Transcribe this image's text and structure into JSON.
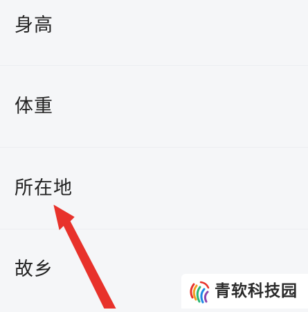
{
  "profile_fields": [
    {
      "label": "身高"
    },
    {
      "label": "体重"
    },
    {
      "label": "所在地"
    },
    {
      "label": "故乡"
    }
  ],
  "annotation": {
    "type": "arrow",
    "color": "#e8322b",
    "points_to": "所在地"
  },
  "watermark": {
    "text": "青软科技园",
    "logo_colors": [
      "#e8322b",
      "#f0a020",
      "#2bb673",
      "#1e88e5",
      "#8e44ad"
    ]
  },
  "colors": {
    "background": "#f5f6f8",
    "label": "#222222"
  }
}
